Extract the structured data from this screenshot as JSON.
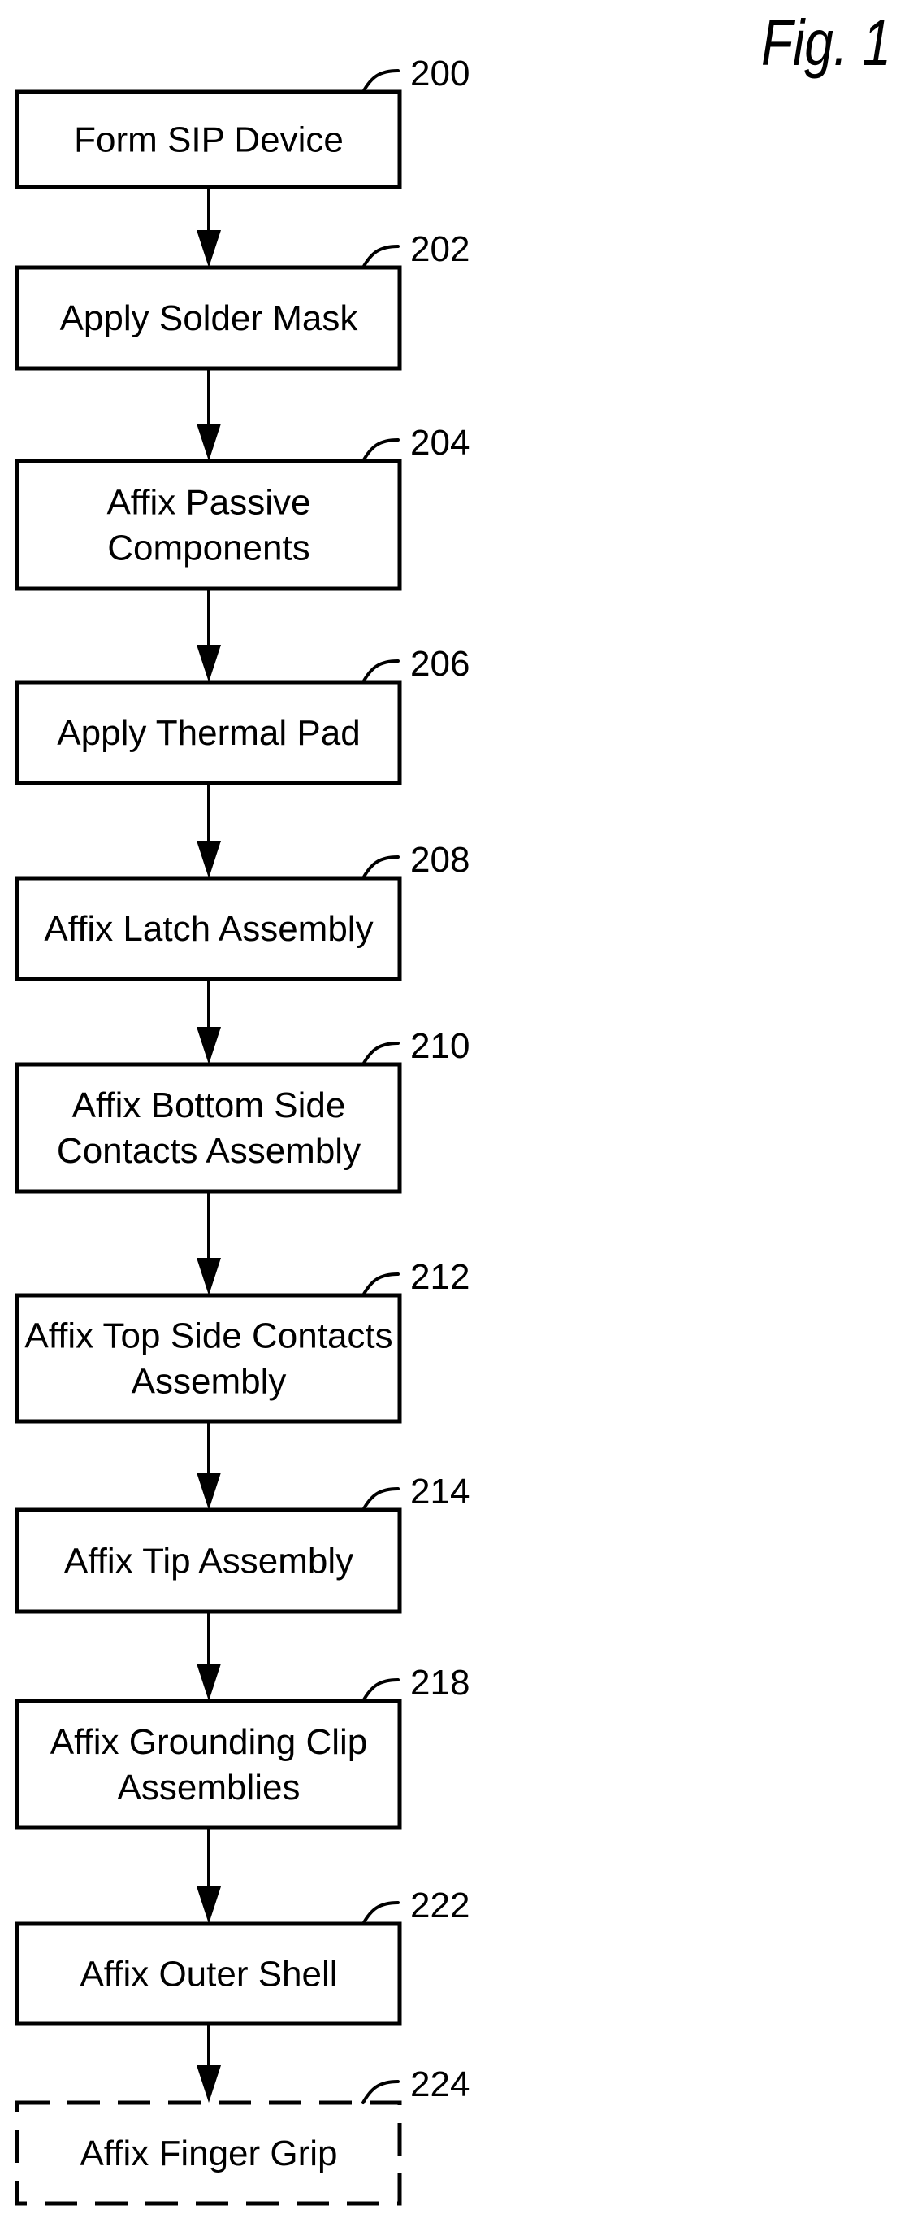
{
  "figure": {
    "title": "Fig. 1"
  },
  "steps": [
    {
      "ref": "200",
      "lines": [
        "Form SIP Device"
      ],
      "style": "solid"
    },
    {
      "ref": "202",
      "lines": [
        "Apply Solder Mask"
      ],
      "style": "solid"
    },
    {
      "ref": "204",
      "lines": [
        "Affix Passive",
        "Components"
      ],
      "style": "solid"
    },
    {
      "ref": "206",
      "lines": [
        "Apply Thermal Pad"
      ],
      "style": "solid"
    },
    {
      "ref": "208",
      "lines": [
        "Affix Latch Assembly"
      ],
      "style": "solid"
    },
    {
      "ref": "210",
      "lines": [
        "Affix Bottom Side",
        "Contacts Assembly"
      ],
      "style": "solid"
    },
    {
      "ref": "212",
      "lines": [
        "Affix Top Side Contacts",
        "Assembly"
      ],
      "style": "solid"
    },
    {
      "ref": "214",
      "lines": [
        "Affix Tip Assembly"
      ],
      "style": "solid"
    },
    {
      "ref": "218",
      "lines": [
        "Affix Grounding Clip",
        "Assemblies"
      ],
      "style": "solid"
    },
    {
      "ref": "222",
      "lines": [
        "Affix Outer Shell"
      ],
      "style": "solid"
    },
    {
      "ref": "224",
      "lines": [
        "Affix Finger Grip"
      ],
      "style": "dashed"
    }
  ],
  "colors": {
    "ink": "#000000",
    "background": "#ffffff"
  }
}
